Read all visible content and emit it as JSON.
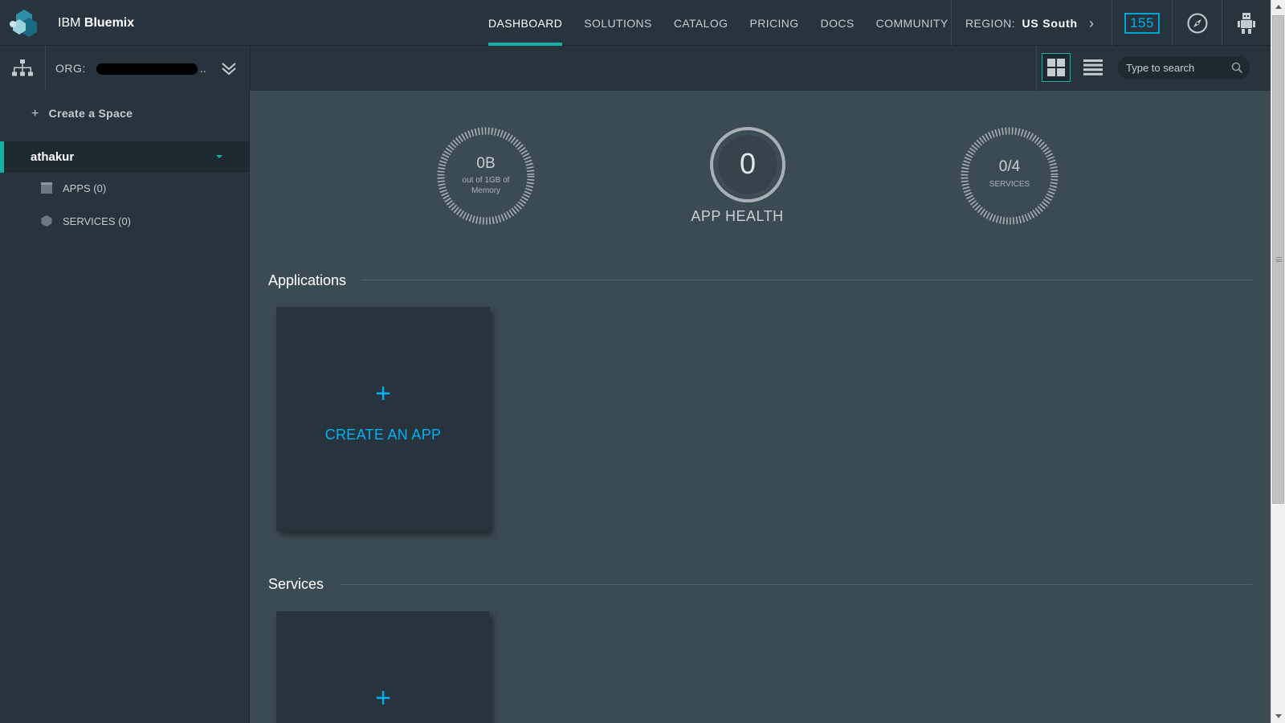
{
  "header": {
    "brand_prefix": "IBM",
    "brand_name": "Bluemix",
    "nav": [
      {
        "label": "DASHBOARD",
        "active": true
      },
      {
        "label": "SOLUTIONS"
      },
      {
        "label": "CATALOG"
      },
      {
        "label": "PRICING"
      },
      {
        "label": "DOCS"
      },
      {
        "label": "COMMUNITY"
      }
    ],
    "region_label": "REGION:",
    "region_value": "US South",
    "notification_count": "155",
    "icons": {
      "compass": "compass-icon",
      "avatar": "robot-avatar-icon"
    }
  },
  "orgbar": {
    "org_label": "ORG:",
    "org_name": "██████████",
    "org_ellipsis": "..",
    "search_placeholder": "Type to search",
    "view_modes": [
      "grid",
      "list"
    ],
    "active_view": "grid"
  },
  "sidebar": {
    "create_space": "Create a Space",
    "space_name": "athakur",
    "apps_label": "APPS (0)",
    "services_label": "SERVICES (0)"
  },
  "summary": {
    "memory_value": "0B",
    "memory_sub_1": "out of 1GB of",
    "memory_sub_2": "Memory",
    "health_value": "0",
    "health_label": "APP HEALTH",
    "services_value": "0/4",
    "services_label": "SERVICES"
  },
  "sections": {
    "applications_title": "Applications",
    "create_app_label": "CREATE AN APP",
    "services_title": "Services"
  },
  "colors": {
    "accent": "#14b1a3",
    "link": "#00b2ef",
    "topbar": "#27343d",
    "main_bg": "#3b4b54"
  }
}
